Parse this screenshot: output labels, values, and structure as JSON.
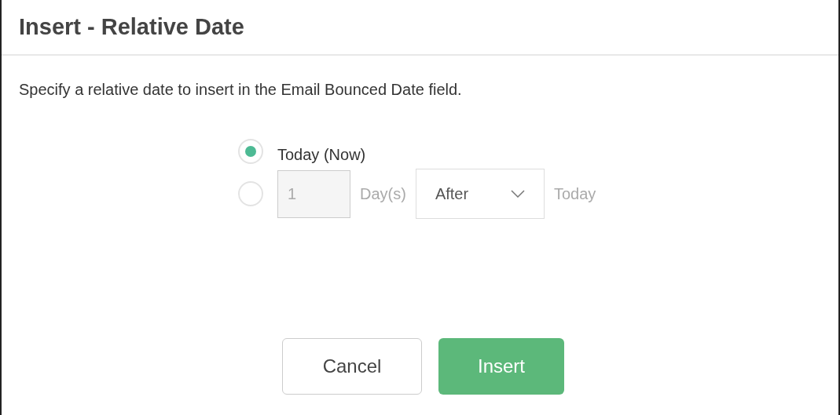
{
  "dialog": {
    "title": "Insert - Relative Date",
    "description": "Specify a relative date to insert in the Email Bounced Date field.",
    "options": [
      {
        "kind": "label",
        "label": "Today (Now)",
        "selected": true
      },
      {
        "kind": "offset",
        "selected": false,
        "amount": "1",
        "unit": "Day(s)",
        "direction": "After",
        "suffix": "Today"
      }
    ],
    "buttons": [
      {
        "kind": "secondary",
        "label": "Cancel"
      },
      {
        "kind": "primary",
        "label": "Insert"
      }
    ]
  }
}
